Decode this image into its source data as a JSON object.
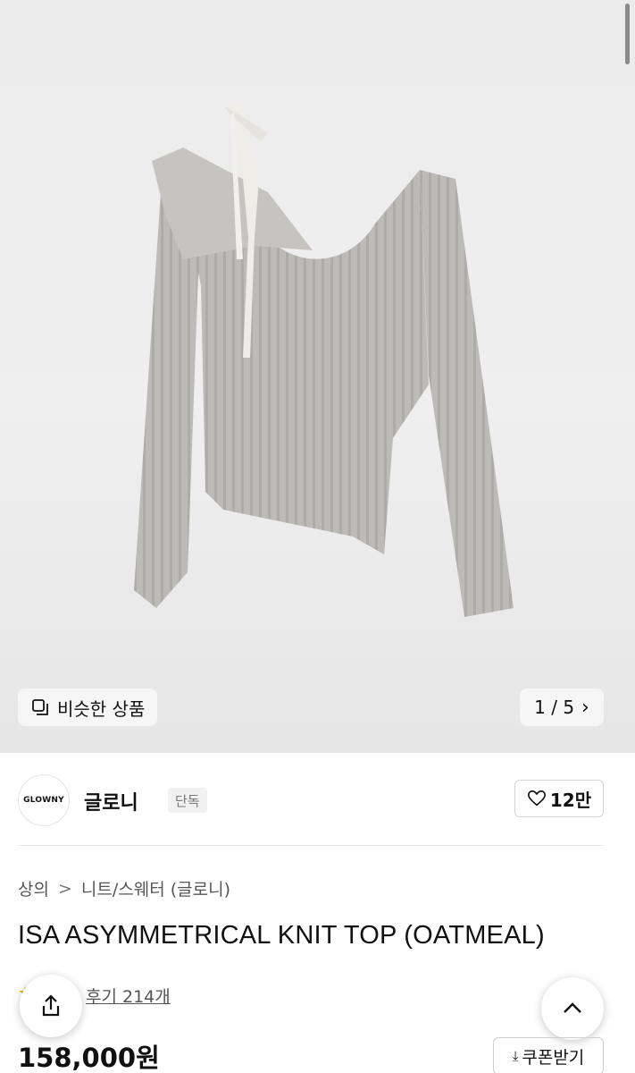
{
  "gallery": {
    "similar_label": "비슷한 상품",
    "page_indicator": "1 / 5"
  },
  "brand": {
    "logo_text": "GLOWNY",
    "name": "글로니",
    "exclusive_badge": "단독",
    "like_count": "12만"
  },
  "breadcrumb": {
    "level1": "상의",
    "separator": ">",
    "level2": "니트/스웨터 (글로니)"
  },
  "product": {
    "title": "ISA ASYMMETRICAL KNIT TOP (OATMEAL)",
    "review_label": "후기 214개",
    "price": "158,000원"
  },
  "actions": {
    "coupon_label": "쿠폰받기"
  },
  "colors": {
    "garment": "#bcbab6",
    "ribbon": "#eceae4",
    "hero_bg": "#ececec"
  }
}
